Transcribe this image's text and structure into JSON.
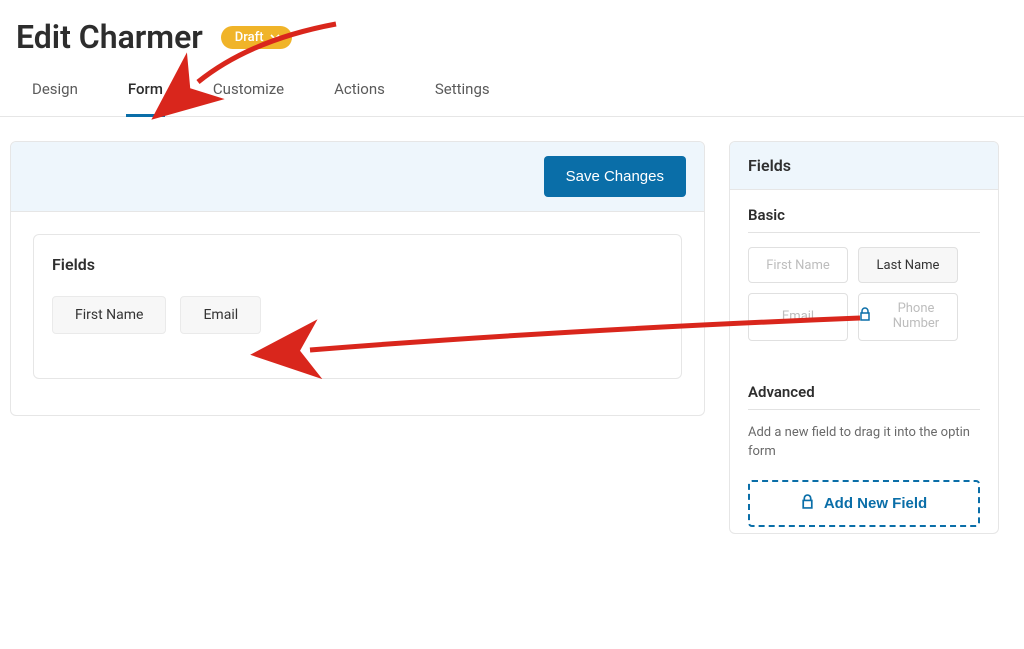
{
  "header": {
    "title": "Edit Charmer",
    "status_label": "Draft"
  },
  "tabs": [
    {
      "label": "Design",
      "active": false
    },
    {
      "label": "Form",
      "active": true
    },
    {
      "label": "Customize",
      "active": false
    },
    {
      "label": "Actions",
      "active": false
    },
    {
      "label": "Settings",
      "active": false
    }
  ],
  "main_panel": {
    "save_button": "Save Changes",
    "fields_section_title": "Fields",
    "placed_fields": [
      "First Name",
      "Email"
    ]
  },
  "side_panel": {
    "title": "Fields",
    "basic": {
      "title": "Basic",
      "items": [
        {
          "label": "First Name",
          "style": "dim",
          "locked": false
        },
        {
          "label": "Last Name",
          "style": "solid",
          "locked": false
        },
        {
          "label": "Email",
          "style": "dim",
          "locked": false
        },
        {
          "label": "Phone Number",
          "style": "dim",
          "locked": true
        }
      ]
    },
    "advanced": {
      "title": "Advanced",
      "hint": "Add a new field to drag it into the optin form",
      "add_button": "Add New Field"
    }
  }
}
